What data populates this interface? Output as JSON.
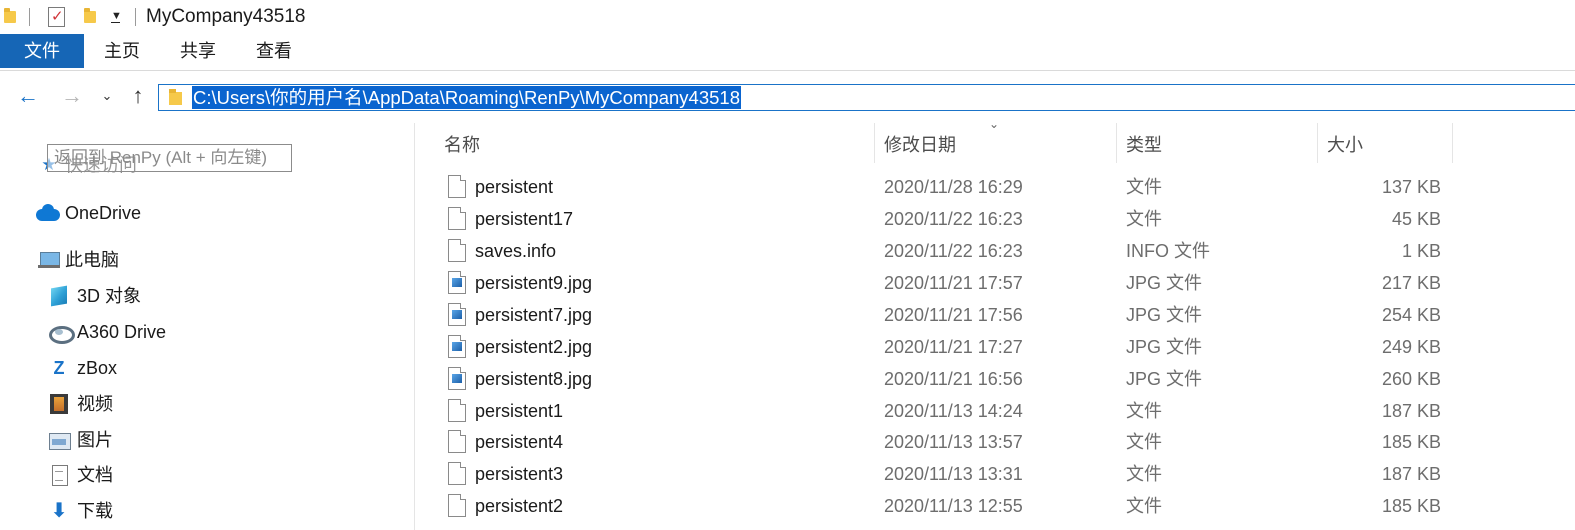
{
  "window": {
    "title": "MyCompany43518"
  },
  "ribbon": {
    "tabs": [
      "文件",
      "主页",
      "共享",
      "查看"
    ]
  },
  "address": {
    "path": "C:\\Users\\你的用户名\\AppData\\Roaming\\RenPy\\MyCompany43518"
  },
  "tooltip": {
    "text": "返回到 RenPy (Alt + 向左键)"
  },
  "sidebar": {
    "items": [
      {
        "label": "快速访问",
        "icon": "star-icon"
      },
      {
        "label": "OneDrive",
        "icon": "cloud-icon"
      },
      {
        "label": "此电脑",
        "icon": "computer-icon"
      },
      {
        "label": "3D 对象",
        "icon": "cube-icon"
      },
      {
        "label": "A360 Drive",
        "icon": "a360-icon"
      },
      {
        "label": "zBox",
        "icon": "zbox-icon"
      },
      {
        "label": "视频",
        "icon": "video-icon"
      },
      {
        "label": "图片",
        "icon": "pictures-icon"
      },
      {
        "label": "文档",
        "icon": "documents-icon"
      },
      {
        "label": "下载",
        "icon": "download-icon"
      }
    ]
  },
  "columns": {
    "name": "名称",
    "date": "修改日期",
    "type": "类型",
    "size": "大小"
  },
  "files": [
    {
      "name": "persistent",
      "date": "2020/11/28 16:29",
      "type": "文件",
      "size": "137 KB",
      "icon": "file-icon"
    },
    {
      "name": "persistent17",
      "date": "2020/11/22 16:23",
      "type": "文件",
      "size": "45 KB",
      "icon": "file-icon"
    },
    {
      "name": "saves.info",
      "date": "2020/11/22 16:23",
      "type": "INFO 文件",
      "size": "1 KB",
      "icon": "file-icon"
    },
    {
      "name": "persistent9.jpg",
      "date": "2020/11/21 17:57",
      "type": "JPG 文件",
      "size": "217 KB",
      "icon": "image-file-icon"
    },
    {
      "name": "persistent7.jpg",
      "date": "2020/11/21 17:56",
      "type": "JPG 文件",
      "size": "254 KB",
      "icon": "image-file-icon"
    },
    {
      "name": "persistent2.jpg",
      "date": "2020/11/21 17:27",
      "type": "JPG 文件",
      "size": "249 KB",
      "icon": "image-file-icon"
    },
    {
      "name": "persistent8.jpg",
      "date": "2020/11/21 16:56",
      "type": "JPG 文件",
      "size": "260 KB",
      "icon": "image-file-icon"
    },
    {
      "name": "persistent1",
      "date": "2020/11/13 14:24",
      "type": "文件",
      "size": "187 KB",
      "icon": "file-icon"
    },
    {
      "name": "persistent4",
      "date": "2020/11/13 13:57",
      "type": "文件",
      "size": "185 KB",
      "icon": "file-icon"
    },
    {
      "name": "persistent3",
      "date": "2020/11/13 13:31",
      "type": "文件",
      "size": "187 KB",
      "icon": "file-icon"
    },
    {
      "name": "persistent2",
      "date": "2020/11/13 12:55",
      "type": "文件",
      "size": "185 KB",
      "icon": "file-icon"
    }
  ],
  "colors": {
    "accent": "#1666b6",
    "selection": "#0a64cf"
  }
}
